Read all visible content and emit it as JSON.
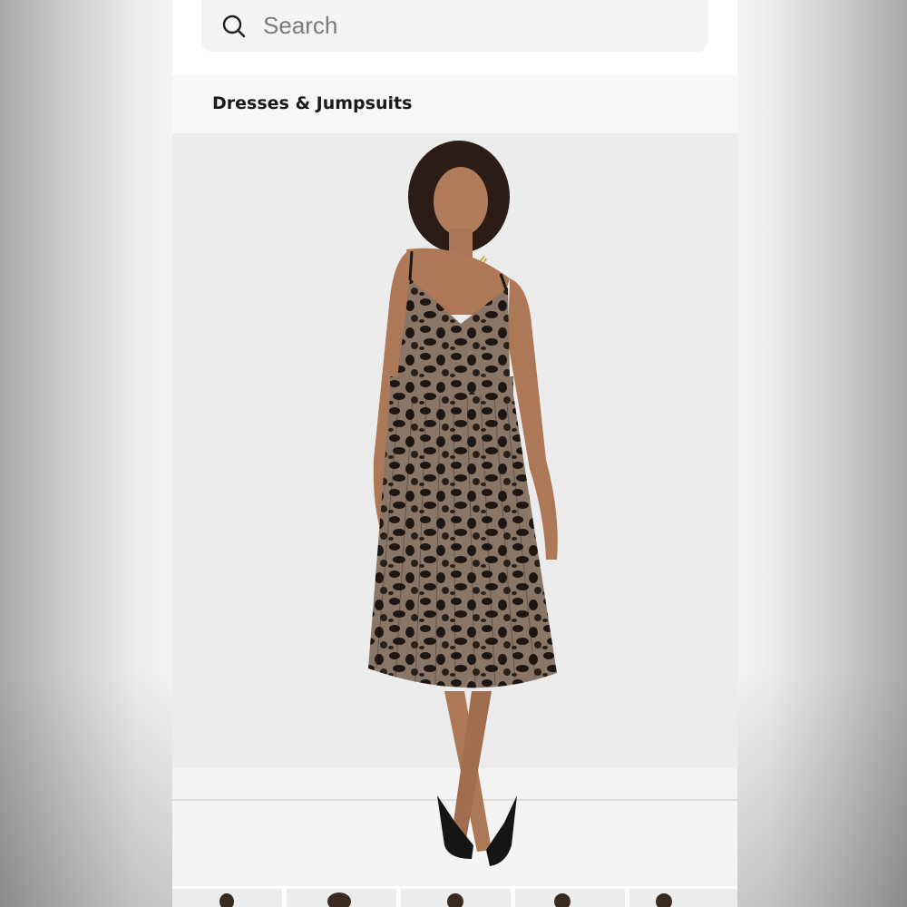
{
  "search": {
    "placeholder": "Search",
    "icon": "search-icon"
  },
  "category": {
    "title": "Dresses & Jumpsuits"
  },
  "product": {
    "image_description_icon": "product-photo",
    "dress_color": "#3b2f27",
    "background_color": "#ececec"
  },
  "thumbnails": {
    "count": 5
  }
}
